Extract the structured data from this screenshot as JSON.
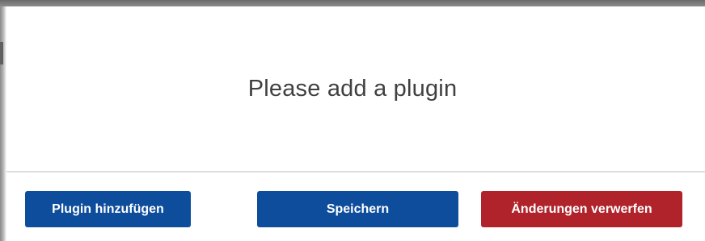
{
  "panel": {
    "message": "Please add a plugin"
  },
  "footer": {
    "add_plugin_label": "Plugin hinzufügen",
    "save_label": "Speichern",
    "discard_label": "Änderungen verwerfen"
  },
  "colors": {
    "primary_button": "#0d4d9c",
    "danger_button": "#b0232a",
    "message_text": "#404040"
  }
}
